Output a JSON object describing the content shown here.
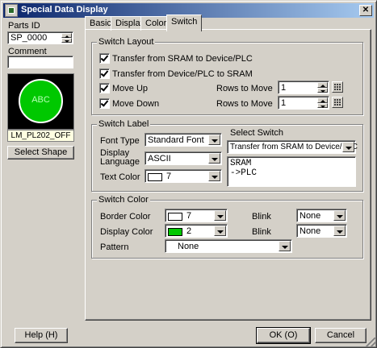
{
  "window": {
    "title": "Special Data Display",
    "close_glyph": "✕"
  },
  "left": {
    "parts_id_label": "Parts ID",
    "parts_id_value": "SP_0000",
    "comment_label": "Comment",
    "comment_value": "",
    "preview_text": "ABC",
    "shape_name": "LM_PL202_OFF",
    "select_shape_button": "Select Shape"
  },
  "tabs": [
    {
      "label": "Basic"
    },
    {
      "label": "Display"
    },
    {
      "label": "Color"
    },
    {
      "label": "Switch",
      "active": true
    }
  ],
  "switch_layout": {
    "legend": "Switch Layout",
    "checks": [
      {
        "label": "Transfer from SRAM to Device/PLC",
        "checked": true
      },
      {
        "label": "Transfer from Device/PLC to SRAM",
        "checked": true
      },
      {
        "label": "Move Up",
        "checked": true
      },
      {
        "label": "Move Down",
        "checked": true
      }
    ],
    "rows_to_move_label": "Rows to Move",
    "move_up_rows": "1",
    "move_down_rows": "1"
  },
  "switch_label": {
    "legend": "Switch Label",
    "font_type_label": "Font Type",
    "font_type_value": "Standard Font",
    "display_language_label": "Display Language",
    "display_language_value": "ASCII",
    "text_color_label": "Text Color",
    "text_color_value": "7",
    "text_color_swatch": "#ffffff",
    "select_switch_label": "Select Switch",
    "select_switch_value": "Transfer from SRAM to Device/PLC",
    "label_text": "SRAM\n->PLC"
  },
  "switch_color": {
    "legend": "Switch Color",
    "border_color_label": "Border Color",
    "border_color_value": "7",
    "border_color_swatch": "#ffffff",
    "display_color_label": "Display Color",
    "display_color_value": "2",
    "display_color_swatch": "#00c800",
    "blink_label": "Blink",
    "border_blink_value": "None",
    "display_blink_value": "None",
    "pattern_label": "Pattern",
    "pattern_value": "None"
  },
  "footer": {
    "help_button": "Help (H)",
    "ok_button": "OK (O)",
    "cancel_button": "Cancel"
  },
  "colors": {
    "title_bar_start": "#0a246a",
    "title_bar_end": "#a6caf0",
    "preview_bg": "#000000",
    "preview_lamp": "#00c800",
    "shape_name_bg": "#ffffe1"
  }
}
